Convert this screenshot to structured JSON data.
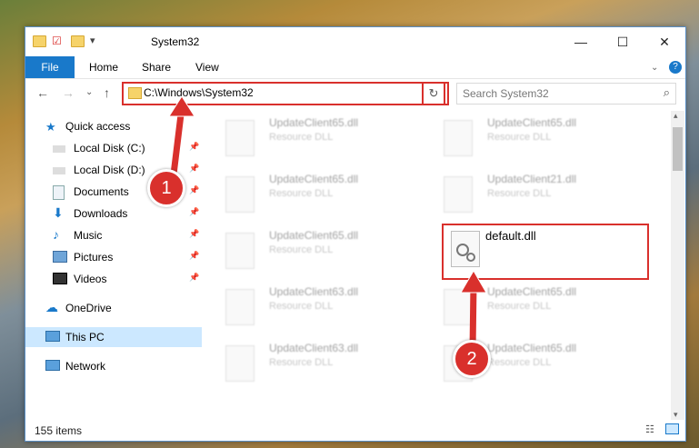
{
  "window": {
    "title": "System32",
    "minimize": "—",
    "maximize": "☐",
    "close": "✕"
  },
  "ribbon": {
    "file": "File",
    "tabs": [
      "Home",
      "Share",
      "View"
    ]
  },
  "nav": {
    "address": "C:\\Windows\\System32",
    "search_placeholder": "Search System32"
  },
  "sidebar": {
    "quick_access": "Quick access",
    "items": [
      {
        "label": "Local Disk (C:)"
      },
      {
        "label": "Local Disk (D:)"
      },
      {
        "label": "Documents"
      },
      {
        "label": "Downloads"
      },
      {
        "label": "Music"
      },
      {
        "label": "Pictures"
      },
      {
        "label": "Videos"
      }
    ],
    "onedrive": "OneDrive",
    "this_pc": "This PC",
    "network": "Network"
  },
  "files": [
    {
      "name": "UpdateClient65.dll",
      "type": "Resource DLL"
    },
    {
      "name": "UpdateClient65.dll",
      "type": "Resource DLL"
    },
    {
      "name": "UpdateClient65.dll",
      "type": "Resource DLL"
    },
    {
      "name": "UpdateClient21.dll",
      "type": "Resource DLL"
    },
    {
      "name": "UpdateClient65.dll",
      "type": "Resource DLL"
    },
    {
      "name": "UpdateClient63.dll",
      "type": "Resource DLL"
    },
    {
      "name": "UpdateClient65.dll",
      "type": "Resource DLL"
    },
    {
      "name": "UpdateClient63.dll",
      "type": "Resource DLL"
    },
    {
      "name": "UpdateClient65.dll",
      "type": "Resource DLL"
    }
  ],
  "highlighted_file": {
    "name": "default.dll"
  },
  "status": {
    "count": "155 items"
  },
  "annotations": {
    "step1": "1",
    "step2": "2",
    "color": "#d9302c"
  }
}
